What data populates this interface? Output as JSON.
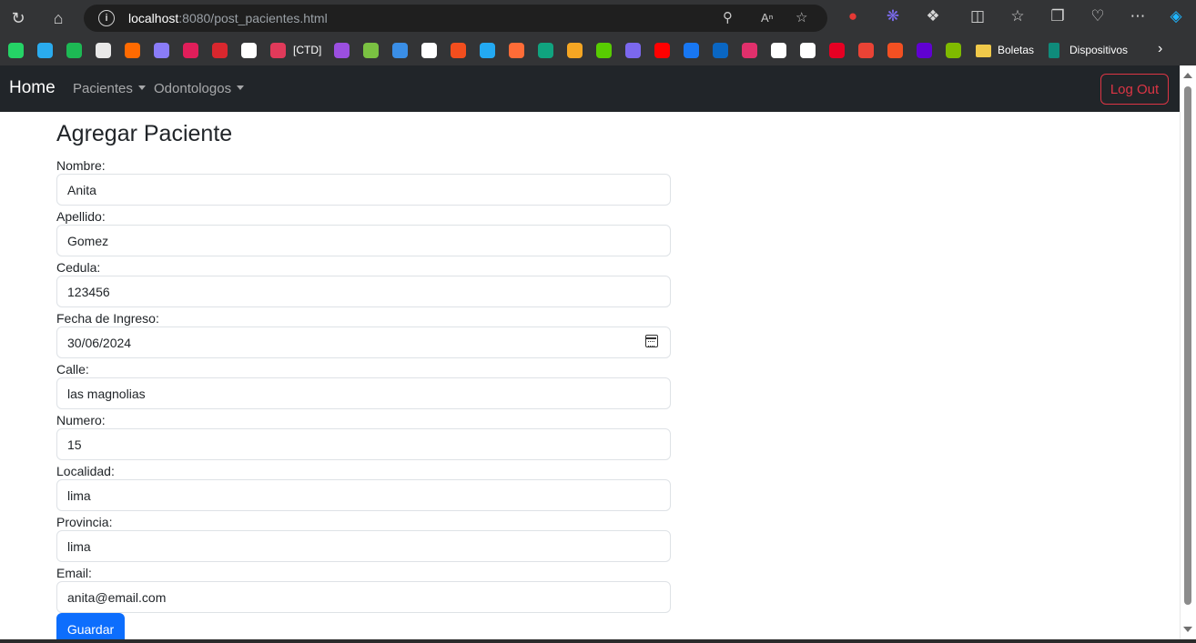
{
  "browser": {
    "url_host": "localhost",
    "url_rest": ":8080/post_pacientes.html",
    "bookmarks": [
      {
        "icon": "whatsapp-icon",
        "color": "#25d366"
      },
      {
        "icon": "telegram-icon",
        "color": "#2aabee"
      },
      {
        "icon": "spotify-icon",
        "color": "#1db954"
      },
      {
        "icon": "chatgpt-icon",
        "color": "#e8e8e8"
      },
      {
        "icon": "m-logo-icon",
        "color": "#ff6a00"
      },
      {
        "icon": "gemini-icon",
        "color": "#8a7cf8"
      },
      {
        "icon": "slack-icon",
        "color": "#e01e5a"
      },
      {
        "icon": "mega-icon",
        "color": "#d9272e"
      },
      {
        "icon": "dev-icon",
        "color": "#ffffff"
      },
      {
        "icon": "heart-icon",
        "color": "#e03a5a"
      },
      {
        "icon": "onenote-icon",
        "color": "#9b4fe0"
      },
      {
        "icon": "diamond-icon",
        "color": "#7ac142"
      },
      {
        "icon": "windows-app-icon",
        "color": "#3a8ee6"
      },
      {
        "icon": "github-icon",
        "color": "#ffffff"
      },
      {
        "icon": "figma-icon",
        "color": "#f24e1e"
      },
      {
        "icon": "vscode-icon",
        "color": "#23a9f2"
      },
      {
        "icon": "postman-icon",
        "color": "#ff6c37"
      },
      {
        "icon": "eye-icon",
        "color": "#10a37f"
      },
      {
        "icon": "r-icon",
        "color": "#f5a623"
      },
      {
        "icon": "duolingo-icon",
        "color": "#58cc02"
      },
      {
        "icon": "s-icon",
        "color": "#7b68ee"
      },
      {
        "icon": "youtube-icon",
        "color": "#ff0000"
      },
      {
        "icon": "facebook-icon",
        "color": "#1877f2"
      },
      {
        "icon": "linkedin-icon",
        "color": "#0a66c2"
      },
      {
        "icon": "instagram-icon",
        "color": "#e1306c"
      },
      {
        "icon": "tiktok-icon",
        "color": "#ffffff"
      },
      {
        "icon": "x-icon",
        "color": "#ffffff"
      },
      {
        "icon": "pinterest-icon",
        "color": "#e60023"
      },
      {
        "icon": "gmail-icon",
        "color": "#ea4335"
      },
      {
        "icon": "microsoft-icon",
        "color": "#f25022"
      },
      {
        "icon": "yahoo-mail-icon",
        "color": "#6001d2"
      },
      {
        "icon": "microsoft-icon",
        "color": "#7fba00"
      }
    ],
    "ctd_label": "[CTD]",
    "folder_label": "Boletas",
    "dispositivos_label": "Dispositivos"
  },
  "nav": {
    "brand": "Home",
    "pacientes": "Pacientes",
    "odontologos": "Odontologos",
    "logout": "Log Out"
  },
  "form": {
    "title": "Agregar Paciente",
    "fields": [
      {
        "label": "Nombre:",
        "value": "Anita"
      },
      {
        "label": "Apellido:",
        "value": "Gomez"
      },
      {
        "label": "Cedula:",
        "value": "123456"
      },
      {
        "label": "Fecha de Ingreso:",
        "value": "30/06/2024"
      },
      {
        "label": "Calle:",
        "value": "las magnolias"
      },
      {
        "label": "Numero:",
        "value": "15"
      },
      {
        "label": "Localidad:",
        "value": "lima"
      },
      {
        "label": "Provincia:",
        "value": "lima"
      },
      {
        "label": "Email:",
        "value": "anita@email.com"
      }
    ],
    "submit": "Guardar"
  }
}
